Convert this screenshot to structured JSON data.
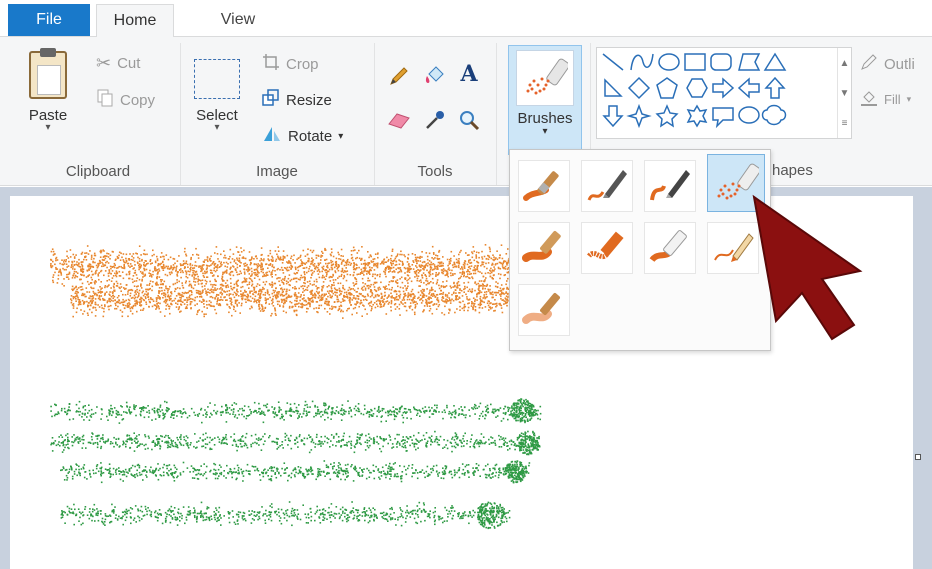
{
  "tabs": {
    "file": "File",
    "home": "Home",
    "view": "View"
  },
  "clipboard": {
    "paste": "Paste",
    "cut": "Cut",
    "copy": "Copy",
    "group": "Clipboard"
  },
  "image": {
    "select": "Select",
    "crop": "Crop",
    "resize": "Resize",
    "rotate": "Rotate",
    "group": "Image"
  },
  "tools": {
    "group": "Tools",
    "text_glyph": "A"
  },
  "brushes": {
    "label": "Brushes",
    "group_partial": "hapes"
  },
  "shapes": {
    "outline": "Outli",
    "fill": "Fill"
  },
  "colors": {
    "accent": "#1979ca",
    "ribbon_bg": "#f5f6f7",
    "orange_paint": "#e8872e",
    "green_paint": "#2e9a44",
    "cursor_red": "#8b1010",
    "selected_bg": "#cde6f7"
  },
  "icons": {
    "cut": "scissors-icon",
    "copy": "copy-icon",
    "crop": "crop-icon",
    "resize": "resize-icon",
    "rotate": "rotate-icon",
    "pencil": "pencil-icon",
    "fill": "fill-bucket-icon",
    "text": "text-icon",
    "eraser": "eraser-icon",
    "picker": "color-picker-icon",
    "magnifier": "magnifier-icon"
  },
  "brush_types": [
    "brush",
    "calligraphy-brush-1",
    "calligraphy-brush-2",
    "airbrush",
    "oil-brush",
    "crayon",
    "marker",
    "natural-pencil",
    "watercolor-brush"
  ],
  "selected_brush_index": 3
}
